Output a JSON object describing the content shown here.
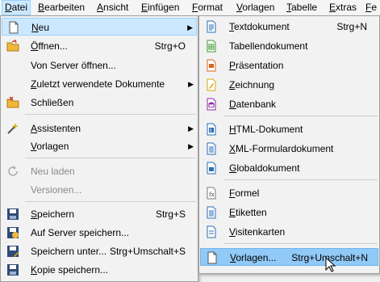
{
  "menubar": {
    "items": [
      "Datei",
      "Bearbeiten",
      "Ansicht",
      "Einfügen",
      "Format",
      "Vorlagen",
      "Tabelle",
      "Extras",
      "Fe"
    ]
  },
  "datei_menu": {
    "items": [
      {
        "label": "Neu",
        "shortcut": "",
        "icon": "new-document-icon"
      },
      {
        "label": "Öffnen...",
        "shortcut": "Strg+O",
        "icon": "open-folder-icon"
      },
      {
        "label": "Von Server öffnen...",
        "shortcut": ""
      },
      {
        "label": "Zuletzt verwendete Dokumente",
        "shortcut": ""
      },
      {
        "label": "Schließen",
        "shortcut": "",
        "icon": "close-folder-icon"
      },
      {
        "label": "Assistenten",
        "shortcut": "",
        "icon": "wizard-icon"
      },
      {
        "label": "Vorlagen",
        "shortcut": ""
      },
      {
        "label": "Neu laden",
        "shortcut": "",
        "icon": "reload-icon"
      },
      {
        "label": "Versionen...",
        "shortcut": ""
      },
      {
        "label": "Speichern",
        "shortcut": "Strg+S",
        "icon": "save-icon"
      },
      {
        "label": "Auf Server speichern...",
        "shortcut": "",
        "icon": "save-remote-icon"
      },
      {
        "label": "Speichern unter...",
        "shortcut": "Strg+Umschalt+S",
        "icon": "save-as-icon"
      },
      {
        "label": "Kopie speichern...",
        "shortcut": "",
        "icon": "save-copy-icon"
      }
    ]
  },
  "neu_menu": {
    "items": [
      {
        "label": "Textdokument",
        "shortcut": "Strg+N",
        "icon": "text-document-icon"
      },
      {
        "label": "Tabellendokument",
        "shortcut": "",
        "icon": "spreadsheet-icon"
      },
      {
        "label": "Präsentation",
        "shortcut": "",
        "icon": "presentation-icon"
      },
      {
        "label": "Zeichnung",
        "shortcut": "",
        "icon": "drawing-icon"
      },
      {
        "label": "Datenbank",
        "shortcut": "",
        "icon": "database-icon"
      },
      {
        "label": "HTML-Dokument",
        "shortcut": "",
        "icon": "html-document-icon"
      },
      {
        "label": "XML-Formulardokument",
        "shortcut": "",
        "icon": "xml-form-icon"
      },
      {
        "label": "Globaldokument",
        "shortcut": "",
        "icon": "master-document-icon"
      },
      {
        "label": "Formel",
        "shortcut": "",
        "icon": "formula-icon"
      },
      {
        "label": "Etiketten",
        "shortcut": "",
        "icon": "labels-icon"
      },
      {
        "label": "Visitenkarten",
        "shortcut": "",
        "icon": "business-cards-icon"
      },
      {
        "label": "Vorlagen...",
        "shortcut": "Strg+Umschalt+N",
        "icon": "templates-icon"
      }
    ]
  },
  "colors": {
    "highlight": "#cce8ff",
    "hover": "#91c9f7",
    "writer": "#2a6fb8",
    "calc": "#3b9a2e",
    "impress": "#d9651f",
    "draw": "#d9a800",
    "base": "#8a2aa6",
    "math": "#7a7a7a"
  }
}
